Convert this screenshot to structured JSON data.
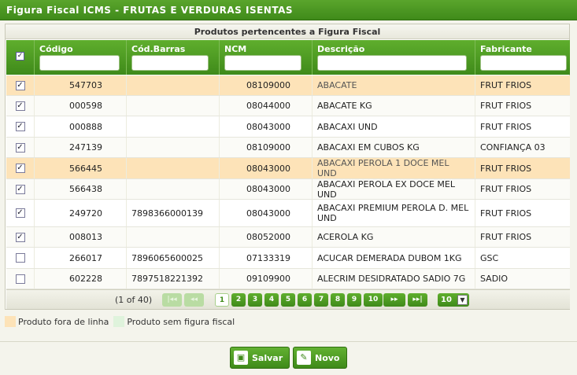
{
  "window": {
    "title": "Figura Fiscal ICMS - FRUTAS E VERDURAS ISENTAS"
  },
  "panel": {
    "caption": "Produtos pertencentes a Figura Fiscal"
  },
  "table": {
    "columns": [
      {
        "label": "Código",
        "filter": ""
      },
      {
        "label": "Cód.Barras",
        "filter": ""
      },
      {
        "label": "NCM",
        "filter": ""
      },
      {
        "label": "Descrição",
        "filter": ""
      },
      {
        "label": "Fabricante",
        "filter": ""
      }
    ],
    "header_checkbox": "checked",
    "rows": [
      {
        "checked": true,
        "codigo": "547703",
        "barras": "",
        "ncm": "08109000",
        "descricao": "ABACATE",
        "fabricante": "FRUT FRIOS",
        "highlight": "fora-de-linha"
      },
      {
        "checked": true,
        "codigo": "000598",
        "barras": "",
        "ncm": "08044000",
        "descricao": "ABACATE KG",
        "fabricante": "FRUT FRIOS",
        "highlight": ""
      },
      {
        "checked": true,
        "codigo": "000888",
        "barras": "",
        "ncm": "08043000",
        "descricao": "ABACAXI UND",
        "fabricante": "FRUT FRIOS",
        "highlight": ""
      },
      {
        "checked": true,
        "codigo": "247139",
        "barras": "",
        "ncm": "08109000",
        "descricao": "ABACAXI EM CUBOS KG",
        "fabricante": "CONFIANÇA 03",
        "highlight": ""
      },
      {
        "checked": true,
        "codigo": "566445",
        "barras": "",
        "ncm": "08043000",
        "descricao": "ABACAXI PEROLA 1 DOCE MEL UND",
        "fabricante": "FRUT FRIOS",
        "highlight": "fora-de-linha"
      },
      {
        "checked": true,
        "codigo": "566438",
        "barras": "",
        "ncm": "08043000",
        "descricao": "ABACAXI PEROLA EX DOCE MEL UND",
        "fabricante": "FRUT FRIOS",
        "highlight": ""
      },
      {
        "checked": true,
        "codigo": "249720",
        "barras": "7898366000139",
        "ncm": "08043000",
        "descricao": "ABACAXI PREMIUM PEROLA D. MEL UND",
        "fabricante": "FRUT FRIOS",
        "highlight": ""
      },
      {
        "checked": true,
        "codigo": "008013",
        "barras": "",
        "ncm": "08052000",
        "descricao": "ACEROLA KG",
        "fabricante": "FRUT FRIOS",
        "highlight": ""
      },
      {
        "checked": false,
        "codigo": "266017",
        "barras": "7896065600025",
        "ncm": "07133319",
        "descricao": "ACUCAR DEMERADA DUBOM 1KG",
        "fabricante": "GSC",
        "highlight": ""
      },
      {
        "checked": false,
        "codigo": "602228",
        "barras": "7897518221392",
        "ncm": "09109900",
        "descricao": "ALECRIM DESIDRATADO SADIO 7G",
        "fabricante": "SADIO",
        "highlight": ""
      }
    ]
  },
  "pager": {
    "info": "(1 of 40)",
    "first": "|◂◂",
    "prev": "◂◂",
    "pages": [
      "1",
      "2",
      "3",
      "4",
      "5",
      "6",
      "7",
      "8",
      "9",
      "10"
    ],
    "current_page": "1",
    "next": "▸▸",
    "last": "▸▸|",
    "rows_per_page": "10",
    "dropdown_arrow": "▼"
  },
  "legend": [
    {
      "label": "Produto fora de linha",
      "color": "#fde3b8"
    },
    {
      "label": "Produto sem figura fiscal",
      "color": "#dff3dc"
    }
  ],
  "actions": {
    "save_label": "Salvar",
    "new_label": "Novo"
  },
  "colors": {
    "accent_green": "#3f8a1a",
    "highlight_row": "#fde3b8"
  }
}
